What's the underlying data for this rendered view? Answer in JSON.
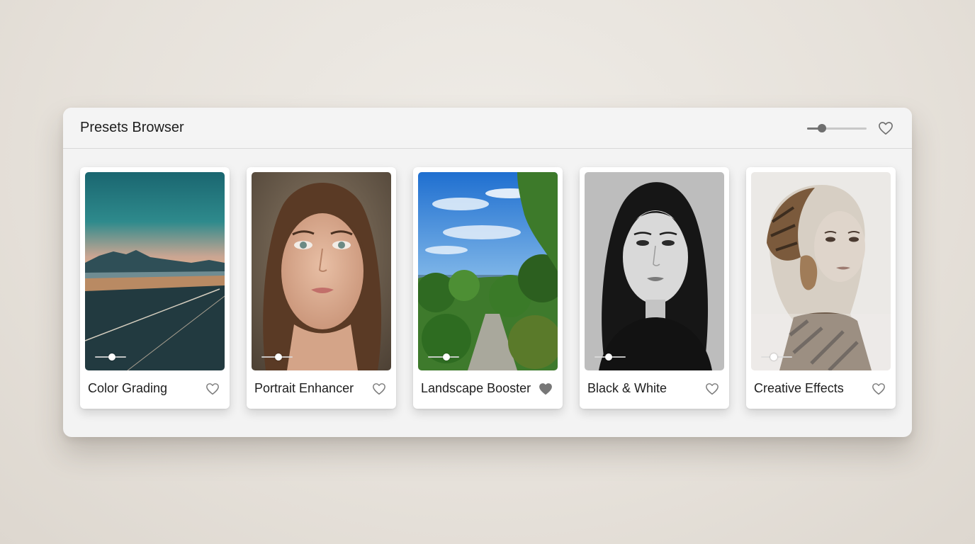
{
  "window": {
    "title": "Presets Browser",
    "thumbnail_size_level": 0.25,
    "favorites_filter_icon": "heart-outline-icon"
  },
  "presets": [
    {
      "name": "Color Grading",
      "intensity": 0.55,
      "favorite": false,
      "icon": "heart-outline-icon"
    },
    {
      "name": "Portrait Enhancer",
      "intensity": 0.55,
      "favorite": false,
      "icon": "heart-outline-icon"
    },
    {
      "name": "Landscape Booster",
      "intensity": 0.6,
      "favorite": true,
      "icon": "heart-filled-icon"
    },
    {
      "name": "Black & White",
      "intensity": 0.45,
      "favorite": false,
      "icon": "heart-outline-icon"
    },
    {
      "name": "Creative Effects",
      "intensity": 0.4,
      "favorite": false,
      "icon": "heart-outline-icon"
    }
  ],
  "colors": {
    "heart_outline": "#8a8a8a",
    "heart_filled": "#777777"
  }
}
